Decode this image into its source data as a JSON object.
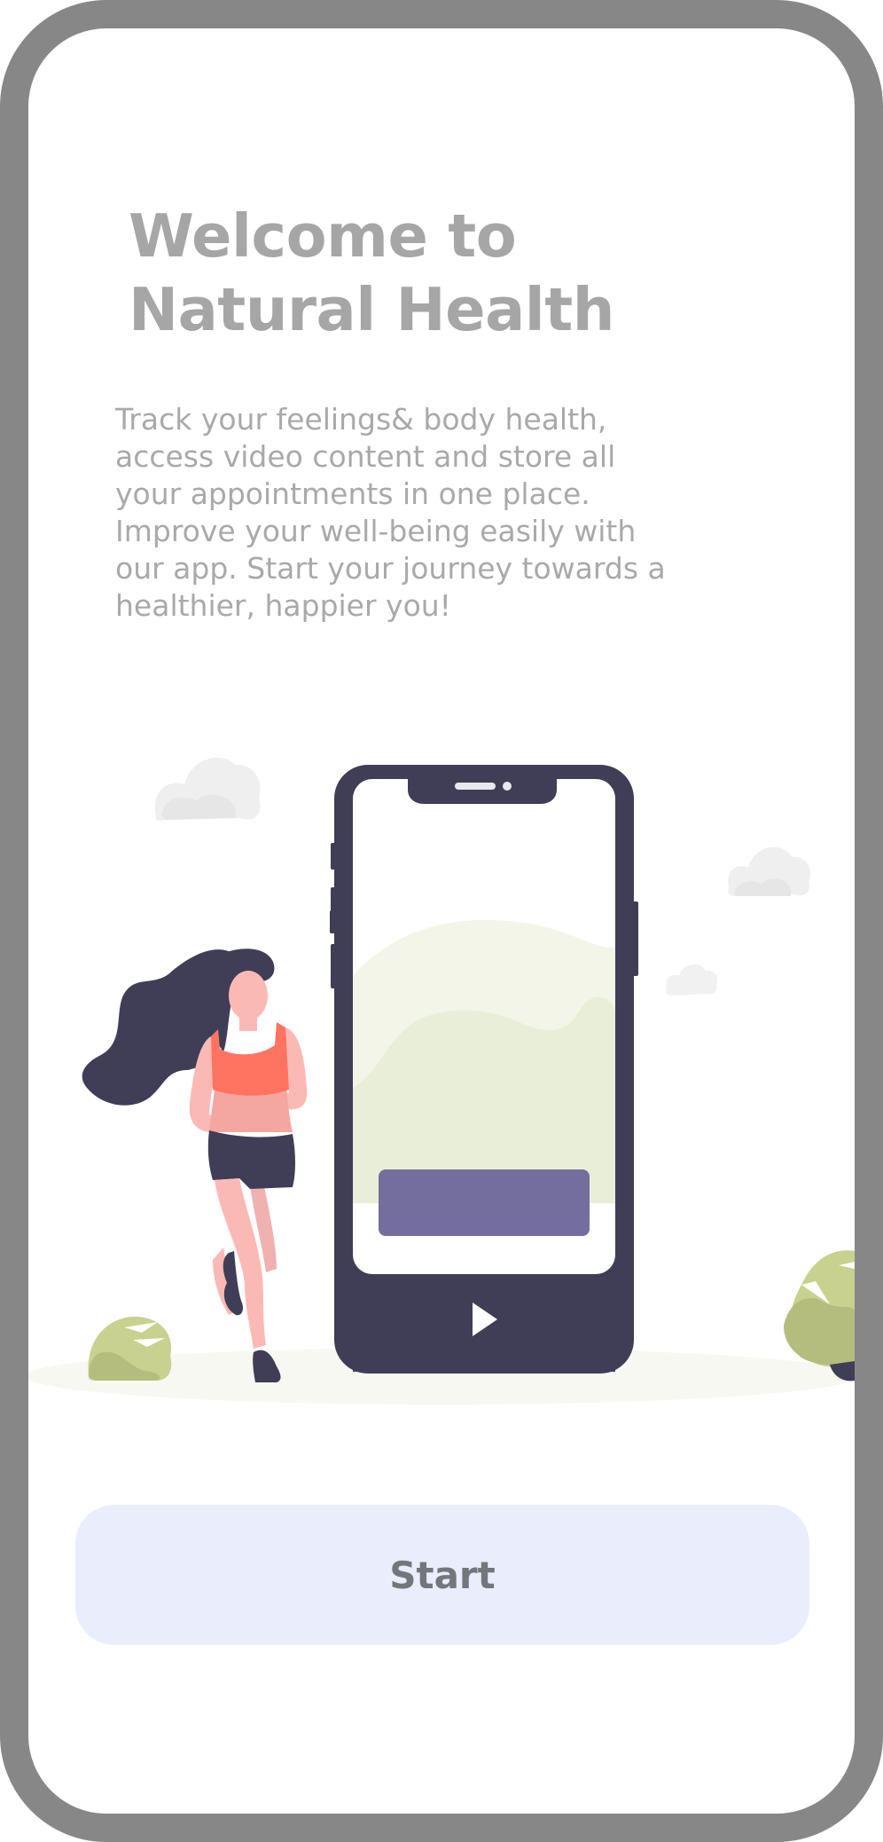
{
  "welcome": {
    "title_line1": "Welcome to",
    "title_line2": "Natural Health",
    "description": "Track your feelings& body health, access video content and store all your appointments in one place. Improve your well-being easily with our app. Start your journey towards a healthier, happier you!"
  },
  "illustration": {
    "icons": [
      "cloud-icon",
      "phone-icon",
      "play-icon",
      "runner-woman-icon",
      "bush-icon"
    ]
  },
  "actions": {
    "start_label": "Start"
  },
  "colors": {
    "frame": "#878787",
    "title": "#a6a6a6",
    "text": "#a9a9a9",
    "phone": "#403d56",
    "phone_button": "#736e9c",
    "start_bg": "#e9edfc",
    "start_text": "#73767b",
    "accent_green": "#c8d18e",
    "shirt": "#ff7360",
    "skin": "#fbb9b5"
  }
}
